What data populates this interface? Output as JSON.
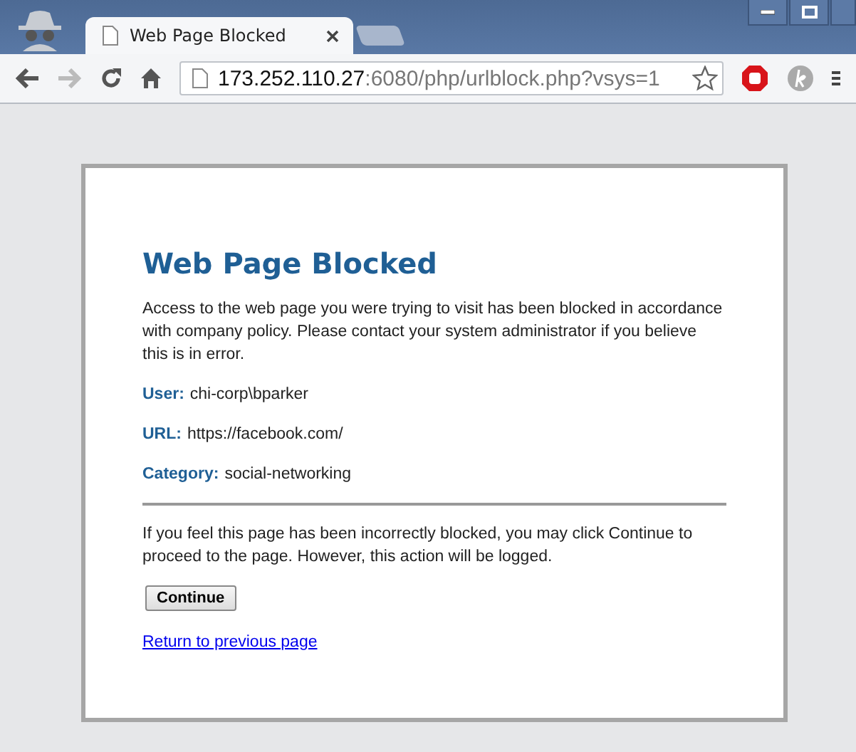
{
  "tab": {
    "title": "Web Page Blocked"
  },
  "address_bar": {
    "host": "173.252.110.27",
    "rest": ":6080/php/urlblock.php?vsys=1"
  },
  "page": {
    "heading": "Web Page Blocked",
    "intro": "Access to the web page you were trying to visit has been blocked in accordance with company policy. Please contact your system administrator if you believe this is in error.",
    "details": [
      {
        "label": "User:",
        "value": "chi-corp\\bparker"
      },
      {
        "label": "URL:",
        "value": "https://facebook.com/"
      },
      {
        "label": "Category:",
        "value": "social-networking"
      }
    ],
    "notice": "If you feel this page has been incorrectly blocked, you may click Continue to proceed to the page. However, this action will be logged.",
    "button": "Continue",
    "link": "Return to previous page"
  }
}
